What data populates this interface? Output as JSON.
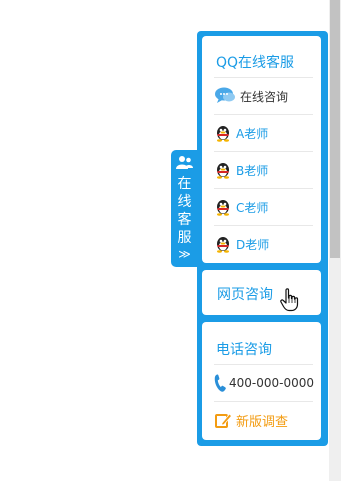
{
  "online_tab": {
    "label": "在线客服",
    "chevron": "≫",
    "icon": "users-icon"
  },
  "qq_box": {
    "title": "QQ在线客服",
    "consult": {
      "label": "在线咨询",
      "icon": "chat-bubble-icon"
    },
    "agents": [
      {
        "label": "A老师",
        "icon": "qq-penguin-icon"
      },
      {
        "label": "B老师",
        "icon": "qq-penguin-icon"
      },
      {
        "label": "C老师",
        "icon": "qq-penguin-icon"
      },
      {
        "label": "D老师",
        "icon": "qq-penguin-icon"
      }
    ]
  },
  "web_box": {
    "title": "网页咨询",
    "cursor_icon": "hand-pointer-icon"
  },
  "phone_box": {
    "title": "电话咨询",
    "phone": {
      "number": "400-000-0000",
      "icon": "phone-icon"
    },
    "survey": {
      "label": "新版调查",
      "icon": "edit-icon"
    }
  },
  "colors": {
    "accent": "#1b9ce6",
    "survey": "#f39c12",
    "divider": "#e8e8e8"
  }
}
